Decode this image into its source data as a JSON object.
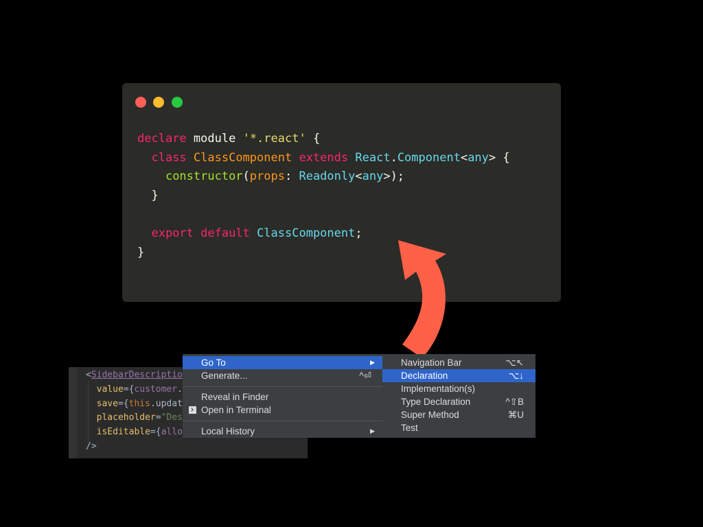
{
  "colors": {
    "code_bg": "#2b2b27",
    "close": "#ff5f57",
    "minimize": "#febc2e",
    "zoom": "#28c840",
    "keyword": "#f92672",
    "class_name": "#fd971f",
    "type_name": "#66d9ef",
    "function_name": "#a6e22e",
    "string": "#e6db74",
    "plain": "#f8f8f2",
    "arrow": "#ff6048",
    "menu_bg": "#3c3f41",
    "menu_highlight": "#2f65ca"
  },
  "code": {
    "lines": [
      [
        {
          "t": "declare",
          "c": "keyword"
        },
        {
          "t": " "
        },
        {
          "t": "module",
          "c": "plain"
        },
        {
          "t": " "
        },
        {
          "t": "'*.react'",
          "c": "string"
        },
        {
          "t": " {"
        }
      ],
      [
        {
          "t": "  "
        },
        {
          "t": "class",
          "c": "keyword"
        },
        {
          "t": " "
        },
        {
          "t": "ClassComponent",
          "c": "class_name"
        },
        {
          "t": " "
        },
        {
          "t": "extends",
          "c": "keyword"
        },
        {
          "t": " "
        },
        {
          "t": "React",
          "c": "type_name"
        },
        {
          "t": "."
        },
        {
          "t": "Component",
          "c": "type_name"
        },
        {
          "t": "<"
        },
        {
          "t": "any",
          "c": "type_name"
        },
        {
          "t": "> {"
        }
      ],
      [
        {
          "t": "    "
        },
        {
          "t": "constructor",
          "c": "function_name"
        },
        {
          "t": "("
        },
        {
          "t": "props",
          "c": "class_name"
        },
        {
          "t": ": "
        },
        {
          "t": "Readonly",
          "c": "type_name"
        },
        {
          "t": "<"
        },
        {
          "t": "any",
          "c": "type_name"
        },
        {
          "t": ">);"
        }
      ],
      [
        {
          "t": "  }"
        }
      ],
      [],
      [
        {
          "t": "  "
        },
        {
          "t": "export",
          "c": "keyword"
        },
        {
          "t": " "
        },
        {
          "t": "default",
          "c": "keyword"
        },
        {
          "t": " "
        },
        {
          "t": "ClassComponent",
          "c": "type_name"
        },
        {
          "t": ";"
        }
      ],
      [
        {
          "t": "}"
        }
      ]
    ]
  },
  "editor": {
    "colors": {
      "tag": "#e8bf6a",
      "attr": "#bababa",
      "ident": "#9876aa",
      "keyword": "#cc7832",
      "string": "#6a8759",
      "plain": "#a9b7c6"
    },
    "lines": [
      [
        {
          "t": "<",
          "c": "plain"
        },
        {
          "t": "SidebarDescriptio",
          "c": "ident",
          "u": true
        }
      ],
      [
        {
          "t": "  value",
          "c": "tag"
        },
        {
          "t": "={",
          "c": "plain"
        },
        {
          "t": "customer",
          "c": "ident"
        },
        {
          "t": ".",
          "c": "plain"
        }
      ],
      [
        {
          "t": "  save",
          "c": "tag"
        },
        {
          "t": "={",
          "c": "plain"
        },
        {
          "t": "this",
          "c": "keyword"
        },
        {
          "t": ".updat",
          "c": "plain"
        }
      ],
      [
        {
          "t": "  placeholder",
          "c": "tag"
        },
        {
          "t": "=",
          "c": "plain"
        },
        {
          "t": "\"Des",
          "c": "string"
        }
      ],
      [
        {
          "t": "  isEditable",
          "c": "tag"
        },
        {
          "t": "={",
          "c": "plain"
        },
        {
          "t": "allo",
          "c": "ident"
        }
      ],
      [
        {
          "t": "/>",
          "c": "plain"
        }
      ]
    ]
  },
  "context_menu": {
    "items": [
      {
        "label": "Go To",
        "submenu": true,
        "highlighted": true
      },
      {
        "label": "Generate...",
        "shortcut": "^⏎"
      },
      {
        "separator": true
      },
      {
        "label": "Reveal in Finder"
      },
      {
        "label": "Open in Terminal",
        "icon": "terminal-icon"
      },
      {
        "separator": true
      },
      {
        "label": "Local History",
        "submenu": true
      }
    ],
    "submenu_arrow": "▶"
  },
  "submenu": {
    "items": [
      {
        "label": "Navigation Bar",
        "shortcut": "⌥↖"
      },
      {
        "label": "Declaration",
        "shortcut": "⌥↓",
        "highlighted": true
      },
      {
        "label": "Implementation(s)"
      },
      {
        "label": "Type Declaration",
        "shortcut": "^⇧B"
      },
      {
        "label": "Super Method",
        "shortcut": "⌘U"
      },
      {
        "label": "Test"
      }
    ]
  }
}
